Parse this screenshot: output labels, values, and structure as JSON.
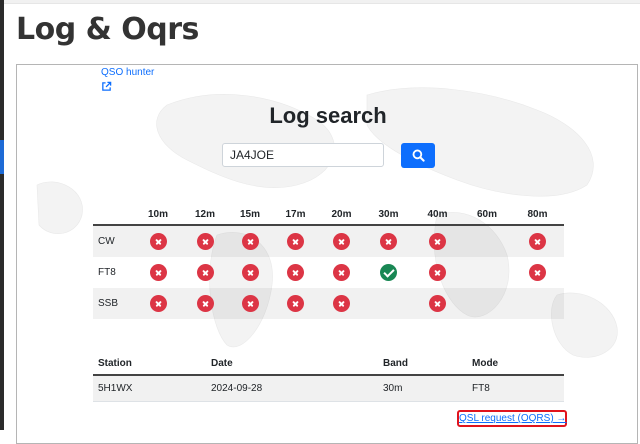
{
  "page_title": "Log & Oqrs",
  "hunter": {
    "link_label": "QSO hunter"
  },
  "search": {
    "title": "Log search",
    "value": "JA4JOE",
    "placeholder": ""
  },
  "bands": [
    "10m",
    "12m",
    "15m",
    "17m",
    "20m",
    "30m",
    "40m",
    "60m",
    "80m"
  ],
  "grid_rows": [
    {
      "mode": "CW",
      "cells": [
        "no",
        "no",
        "no",
        "no",
        "no",
        "yes-unconfirmed-no",
        "no",
        "",
        "no"
      ]
    },
    {
      "mode": "FT8",
      "cells": [
        "no",
        "no",
        "no",
        "no",
        "no",
        "yes",
        "no",
        "",
        "no"
      ]
    },
    {
      "mode": "SSB",
      "cells": [
        "no",
        "no",
        "no",
        "no",
        "no",
        "",
        "no",
        "",
        ""
      ]
    }
  ],
  "results": {
    "headers": [
      "Station",
      "Date",
      "Band",
      "Mode"
    ],
    "rows": [
      [
        "5H1WX",
        "2024-09-28",
        "30m",
        "FT8"
      ]
    ]
  },
  "qsl_link_label": "QSL request (OQRS) →",
  "colors": {
    "accent": "#0d6efd",
    "not_worked": "#dc3545",
    "worked": "#198754",
    "highlight": "#e0141e"
  }
}
